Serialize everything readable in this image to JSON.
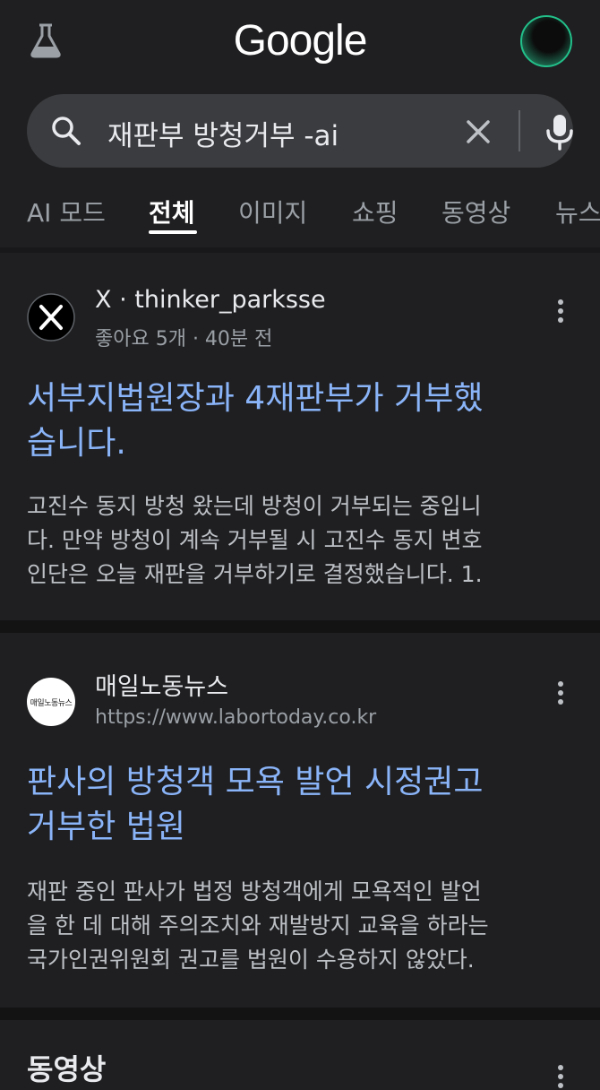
{
  "header": {
    "logo_text": "Google"
  },
  "search": {
    "query": "재판부 방청거부 -ai"
  },
  "tabs": [
    {
      "label": "AI 모드"
    },
    {
      "label": "전체"
    },
    {
      "label": "이미지"
    },
    {
      "label": "쇼핑"
    },
    {
      "label": "동영상"
    },
    {
      "label": "뉴스"
    }
  ],
  "results": [
    {
      "source_name": "X · thinker_parksse",
      "source_sub": "좋아요 5개 · 40분 전",
      "title_line1": "서부지법원장과 4재판부가 거부했",
      "title_line2": "습니다.",
      "snippet_line1": "고진수 동지 방청 왔는데 방청이 거부되는 중입니",
      "snippet_line2": "다. 만약 방청이 계속 거부될 시 고진수 동지 변호",
      "snippet_line3": "인단은 오늘 재판을 거부하기로 결정했습니다. 1."
    },
    {
      "source_name": "매일노동뉴스",
      "source_sub": "https://www.labortoday.co.kr",
      "logo_text": "매일노동뉴스",
      "title_line1": "판사의 방청객 모욕 발언 시정권고",
      "title_line2": "거부한 법원",
      "snippet_line1": "재판 중인 판사가 법정 방청객에게 모욕적인 발언",
      "snippet_line2": "을 한 데 대해 주의조치와 재발방지 교육을 하라는",
      "snippet_line3": "국가인권위원회 권고를 법원이 수용하지 않았다."
    }
  ],
  "next_section": {
    "title": "동영상"
  }
}
